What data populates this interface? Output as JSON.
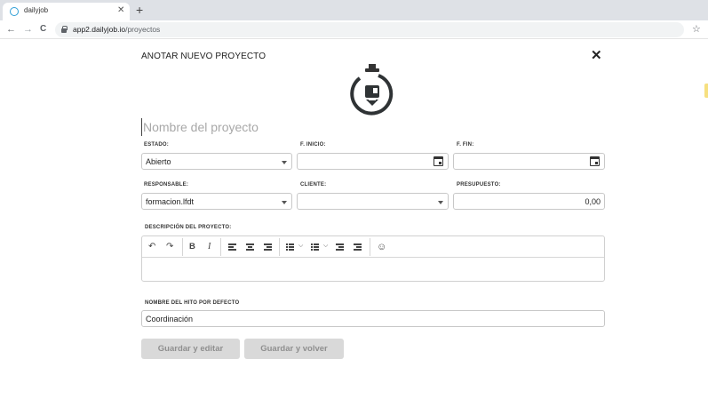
{
  "browser": {
    "tab_title": "dailyjob",
    "tab_close": "✕",
    "new_tab": "+",
    "url_host": "app2.dailyjob.io",
    "url_path": "/proyectos",
    "back": "←",
    "forward": "→",
    "reload": "C",
    "star": "☆",
    "favicon": "dailyjob-ring-icon",
    "accent": "#2e9fd6"
  },
  "modal": {
    "title": "ANOTAR NUEVO PROYECTO",
    "close": "✕",
    "icon": "project-marker-icon",
    "name_placeholder": "Nombre del proyecto"
  },
  "fields": {
    "estado": {
      "label": "ESTADO:",
      "value": "Abierto"
    },
    "inicio": {
      "label": "F. INICIO:",
      "value": ""
    },
    "fin": {
      "label": "F. FIN:",
      "value": ""
    },
    "responsable": {
      "label": "RESPONSABLE:",
      "value": "formacion.lfdt"
    },
    "cliente": {
      "label": "CLIENTE:",
      "value": ""
    },
    "presupuesto": {
      "label": "PRESUPUESTO:",
      "value": "0,00"
    },
    "descripcion": {
      "label": "DESCRIPCIÓN DEL PROYECTO:"
    },
    "hito": {
      "label": "NOMBRE DEL HITO POR DEFECTO",
      "value": "Coordinación"
    }
  },
  "editor_toolbar": {
    "undo": "↶",
    "redo": "↷",
    "bold": "B",
    "italic": "I",
    "emoji": "☺",
    "icons": [
      "undo-icon",
      "redo-icon",
      "bold-icon",
      "italic-icon",
      "align-left-icon",
      "align-center-icon",
      "align-right-icon",
      "bullet-list-icon",
      "numbered-list-icon",
      "outdent-icon",
      "indent-icon",
      "emoji-icon"
    ]
  },
  "buttons": {
    "save_edit": "Guardar y editar",
    "save_back": "Guardar y volver"
  }
}
